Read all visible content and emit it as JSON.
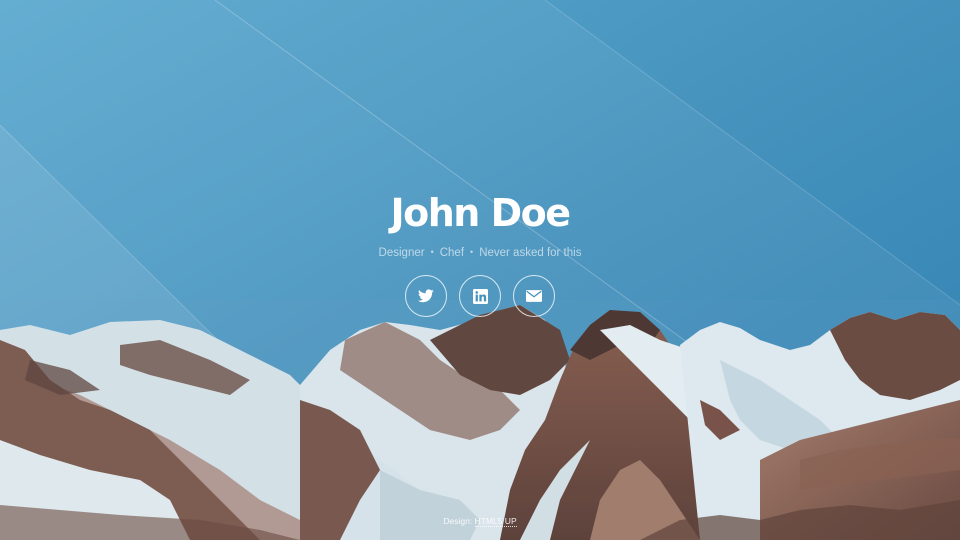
{
  "header": {
    "name": "John Doe",
    "tagline": {
      "items": [
        "Designer",
        "Chef",
        "Never asked for this"
      ],
      "separator": "•"
    }
  },
  "social": [
    {
      "name": "twitter",
      "icon": "twitter-icon"
    },
    {
      "name": "linkedin",
      "icon": "linkedin-icon"
    },
    {
      "name": "email",
      "icon": "envelope-icon"
    }
  ],
  "footer": {
    "prefix": "Design:",
    "link_label": "HTML5 UP"
  },
  "colors": {
    "sky_top": "#3a8ab6",
    "sky_light": "#5aa6cc",
    "snow": "#e6eef2",
    "rock_dark": "#5b3b32",
    "rock_mid": "#8a5a48",
    "rock_light": "#a87862"
  }
}
